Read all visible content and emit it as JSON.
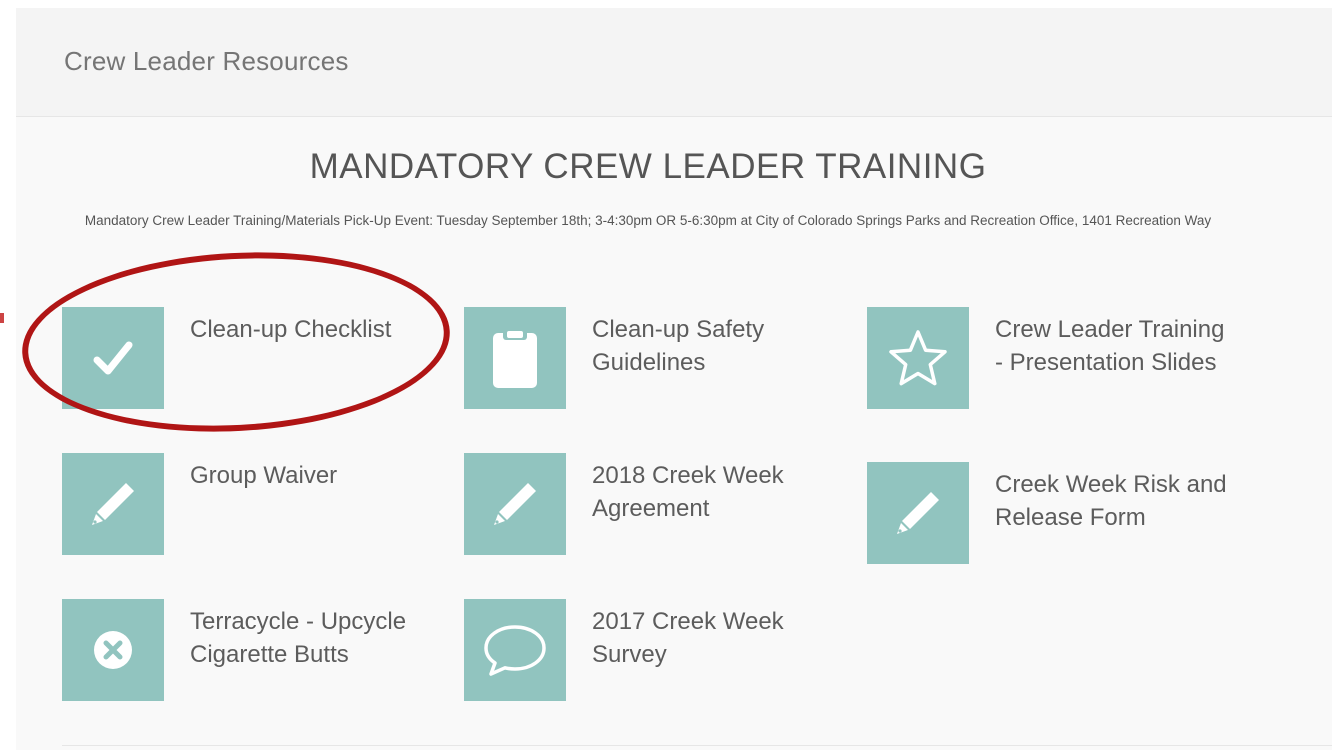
{
  "panel": {
    "title": "Crew Leader Resources"
  },
  "section": {
    "heading": "MANDATORY CREW LEADER TRAINING",
    "subtitle": "Mandatory Crew Leader Training/Materials Pick-Up Event: Tuesday September 18th; 3-4:30pm OR 5-6:30pm at City of Colorado Springs Parks and Recreation Office, 1401 Recreation Way"
  },
  "theme": {
    "tile_color": "#91c4bf",
    "icon_color": "#ffffff",
    "annotation_color": "#b01515"
  },
  "resources": [
    {
      "label": "Clean-up Checklist",
      "icon": "checkmark-icon"
    },
    {
      "label": "Clean-up Safety Guidelines",
      "icon": "clipboard-icon"
    },
    {
      "label": "Crew Leader Training - Presentation Slides",
      "icon": "star-icon"
    },
    {
      "label": "Group Waiver",
      "icon": "pencil-icon"
    },
    {
      "label": "2018 Creek Week Agreement",
      "icon": "pencil-icon"
    },
    {
      "label": "Creek Week Risk and Release Form",
      "icon": "pencil-icon"
    },
    {
      "label": "Terracycle - Upcycle Cigarette Butts",
      "icon": "close-circle-icon"
    },
    {
      "label": "2017 Creek Week Survey",
      "icon": "speech-bubble-icon"
    }
  ]
}
